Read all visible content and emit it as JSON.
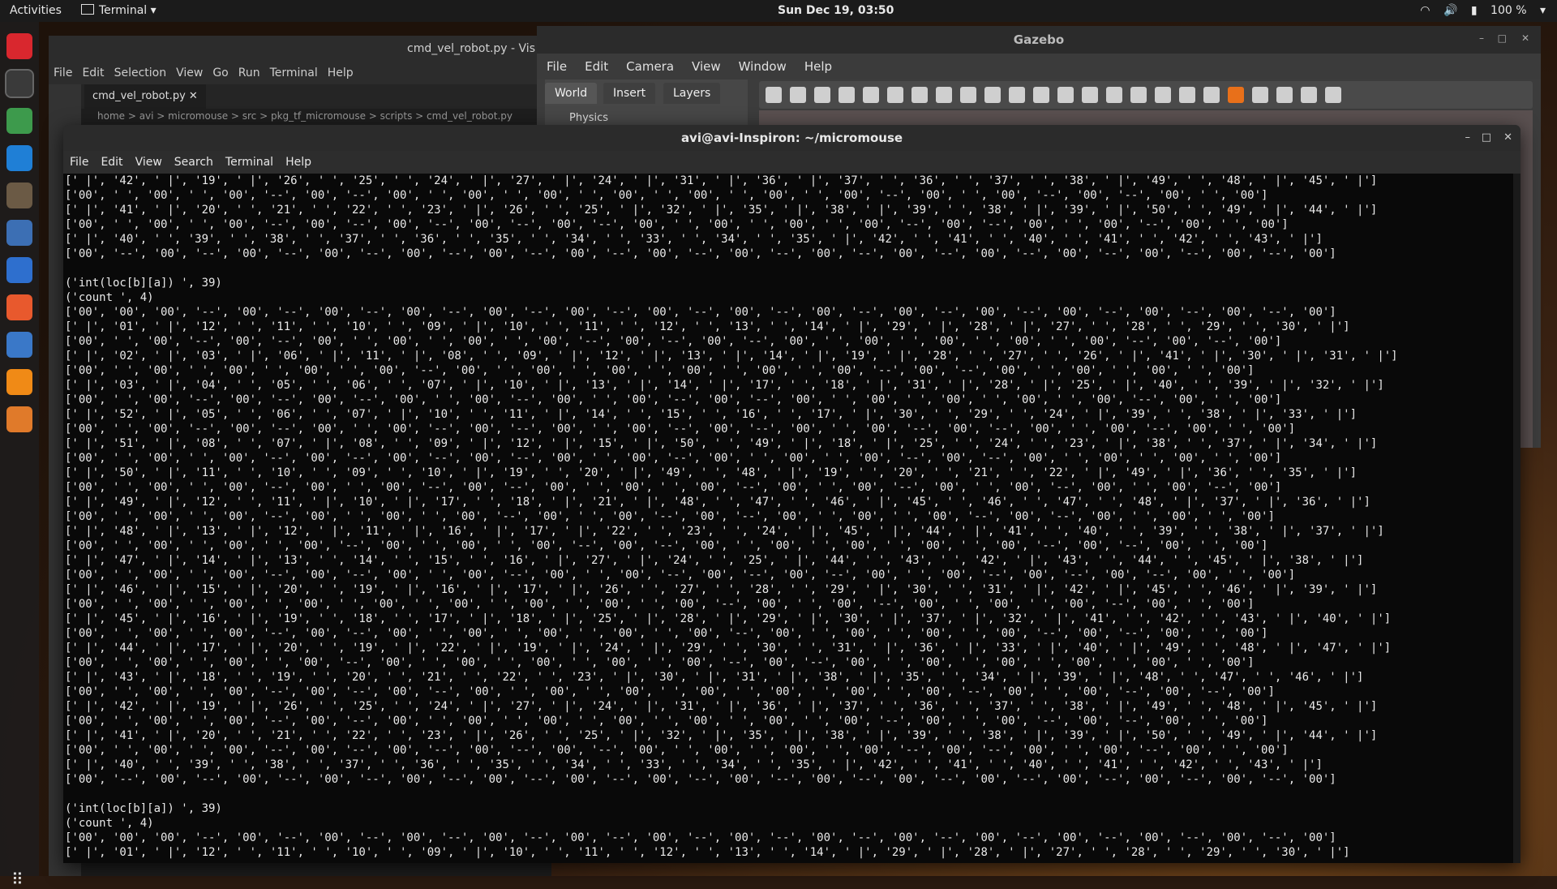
{
  "topbar": {
    "activities": "Activities",
    "app": "Terminal",
    "clock": "Sun Dec 19, 03:50",
    "battery": "100 %"
  },
  "dock": {
    "icons": [
      "opera-icon",
      "terminal-icon",
      "chrome-icon",
      "vscode-icon",
      "files-icon",
      "system-monitor-icon",
      "writer-icon",
      "software-icon",
      "help-icon",
      "vlc-icon",
      "layers-icon"
    ],
    "colors": [
      "#d9272e",
      "#3a3a3a",
      "#3d9a4c",
      "#1f7fd6",
      "#6b5a45",
      "#3c6fb4",
      "#2e6fce",
      "#e8592d",
      "#3a78c8",
      "#f08a16",
      "#e07a2a"
    ]
  },
  "vscode": {
    "title": "cmd_vel_robot.py - Vis",
    "menu": [
      "File",
      "Edit",
      "Selection",
      "View",
      "Go",
      "Run",
      "Terminal",
      "Help"
    ],
    "tab": "cmd_vel_robot.py",
    "breadcrumb": "home > avi > micromouse > src > pkg_tf_micromouse > scripts > cmd_vel_robot.py"
  },
  "gazebo": {
    "title": "Gazebo",
    "menu": [
      "File",
      "Edit",
      "Camera",
      "View",
      "Window",
      "Help"
    ],
    "tabs": [
      "World",
      "Insert",
      "Layers"
    ],
    "physics": "Physics"
  },
  "terminal": {
    "title": "avi@avi-Inspiron: ~/micromouse",
    "menu": [
      "File",
      "Edit",
      "View",
      "Search",
      "Terminal",
      "Help"
    ],
    "lines": [
      "[' |', '42', ' |', '19', ' |', '26', ' ', '25', ' ', '24', ' |', '27', ' |', '24', ' |', '31', ' |', '36', ' |', '37', ' ', '36', ' ', '37', ' ', '38', ' |', '49', ' ', '48', ' |', '45', ' |']",
      "['00', ' ', '00', ' ', '00', '--', '00', '--', '00', ' ', '00', ' ', '00', ' ', '00', ' ', '00', ' ', '00', ' ', '00', '--', '00', ' ', '00', '--', '00', '--', '00', ' ', '00']",
      "[' |', '41', ' |', '20', ' ', '21', ' ', '22', ' ', '23', ' |', '26', ' ', '25', ' |', '32', ' |', '35', ' |', '38', ' |', '39', ' ', '38', ' |', '39', ' |', '50', ' ', '49', ' |', '44', ' |']",
      "['00', ' ', '00', ' ', '00', '--', '00', '--', '00', '--', '00', '--', '00', '--', '00', ' ', '00', ' ', '00', ' ', '00', '--', '00', '--', '00', ' ', '00', '--', '00', ' ', '00']",
      "[' |', '40', ' ', '39', ' ', '38', ' ', '37', ' ', '36', ' ', '35', ' ', '34', ' ', '33', ' ', '34', ' ', '35', ' |', '42', ' ', '41', ' ', '40', ' ', '41', ' ', '42', ' ', '43', ' |']",
      "['00', '--', '00', '--', '00', '--', '00', '--', '00', '--', '00', '--', '00', '--', '00', '--', '00', '--', '00', '--', '00', '--', '00', '--', '00', '--', '00', '--', '00', '--', '00']",
      "",
      "('int(loc[b][a]) ', 39)",
      "('count ', 4)",
      "['00', '00', '00', '--', '00', '--', '00', '--', '00', '--', '00', '--', '00', '--', '00', '--', '00', '--', '00', '--', '00', '--', '00', '--', '00', '--', '00', '--', '00', '--', '00']",
      "[' |', '01', ' |', '12', ' ', '11', ' ', '10', ' ', '09', ' |', '10', ' ', '11', ' ', '12', ' ', '13', ' ', '14', ' |', '29', ' |', '28', ' |', '27', ' ', '28', ' ', '29', ' ', '30', ' |']",
      "['00', ' ', '00', '--', '00', '--', '00', ' ', '00', ' ', '00', ' ', '00', '--', '00', '--', '00', '--', '00', ' ', '00', ' ', '00', ' ', '00', ' ', '00', '--', '00', '--', '00']",
      "[' |', '02', ' |', '03', ' |', '06', ' |', '11', ' |', '08', ' ', '09', ' |', '12', ' |', '13', ' |', '14', ' |', '19', ' |', '28', ' ', '27', ' ', '26', ' |', '41', ' |', '30', ' |', '31', ' |']",
      "['00', ' ', '00', ' ', '00', ' ', '00', ' ', '00', '--', '00', ' ', '00', ' ', '00', ' ', '00', ' ', '00', ' ', '00', '--', '00', '--', '00', ' ', '00', ' ', '00', ' ', '00']",
      "[' |', '03', ' |', '04', ' ', '05', ' ', '06', ' ', '07', ' |', '10', ' |', '13', ' |', '14', ' |', '17', ' ', '18', ' |', '31', ' |', '28', ' |', '25', ' |', '40', ' ', '39', ' |', '32', ' |']",
      "['00', ' ', '00', '--', '00', '--', '00', '--', '00', ' ', '00', '--', '00', ' ', '00', '--', '00', '--', '00', ' ', '00', ' ', '00', ' ', '00', ' ', '00', '--', '00', ' ', '00']",
      "[' |', '52', ' |', '05', ' ', '06', ' ', '07', ' |', '10', ' ', '11', ' |', '14', ' ', '15', ' ', '16', ' ', '17', ' |', '30', ' ', '29', ' ', '24', ' |', '39', ' ', '38', ' |', '33', ' |']",
      "['00', ' ', '00', '--', '00', '--', '00', ' ', '00', '--', '00', '--', '00', ' ', '00', '--', '00', '--', '00', ' ', '00', '--', '00', '--', '00', ' ', '00', '--', '00', ' ', '00']",
      "[' |', '51', ' |', '08', ' ', '07', ' |', '08', ' ', '09', ' |', '12', ' |', '15', ' |', '50', ' ', '49', ' |', '18', ' |', '25', ' ', '24', ' ', '23', ' |', '38', ' ', '37', ' |', '34', ' |']",
      "['00', ' ', '00', ' ', '00', '--', '00', '--', '00', '--', '00', '--', '00', ' ', '00', '--', '00', ' ', '00', ' ', '00', '--', '00', '--', '00', ' ', '00', ' ', '00', ' ', '00']",
      "[' |', '50', ' |', '11', ' ', '10', ' ', '09', ' ', '10', ' |', '19', ' ', '20', ' |', '49', ' ', '48', ' |', '19', ' ', '20', ' ', '21', ' ', '22', ' |', '49', ' |', '36', ' ', '35', ' |']",
      "['00', ' ', '00', ' ', '00', '--', '00', ' ', '00', '--', '00', '--', '00', ' ', '00', ' ', '00', '--', '00', ' ', '00', '--', '00', ' ', '00', '--', '00', ' ', '00', '--', '00']",
      "[' |', '49', ' |', '12', ' ', '11', ' |', '10', ' |', '17', ' ', '18', ' |', '21', ' |', '48', ' ', '47', ' ', '46', ' |', '45', ' ', '46', ' ', '47', ' ', '48', ' |', '37', ' |', '36', ' |']",
      "['00', ' ', '00', ' ', '00', '--', '00', ' ', '00', ' ', '00', '--', '00', ' ', '00', '--', '00', '--', '00', ' ', '00', ' ', '00', '--', '00', '--', '00', ' ', '00', ' ', '00']",
      "[' |', '48', ' |', '13', ' |', '12', ' |', '11', ' |', '16', ' |', '17', ' |', '22', ' ', '23', ' ', '24', ' |', '45', ' |', '44', ' |', '41', ' ', '40', ' ', '39', ' ', '38', ' |', '37', ' |']",
      "['00', ' ', '00', ' ', '00', ' ', '00', '--', '00', ' ', '00', ' ', '00', '--', '00', '--', '00', ' ', '00', ' ', '00', ' ', '00', ' ', '00', '--', '00', '--', '00', ' ', '00']",
      "[' |', '47', ' |', '14', ' |', '13', ' ', '14', ' ', '15', ' ', '16', ' |', '27', ' |', '24', ' ', '25', ' |', '44', ' ', '43', ' ', '42', ' |', '43', ' ', '44', ' ', '45', ' |', '38', ' |']",
      "['00', ' ', '00', ' ', '00', '--', '00', '--', '00', ' ', '00', '--', '00', ' ', '00', '--', '00', '--', '00', '--', '00', ' ', '00', '--', '00', '--', '00', '--', '00', ' ', '00']",
      "[' |', '46', ' |', '15', ' |', '20', ' ', '19', ' |', '16', ' |', '17', ' |', '26', ' ', '27', ' ', '28', ' ', '29', ' |', '30', ' ', '31', ' |', '42', ' |', '45', ' ', '46', ' |', '39', ' |']",
      "['00', ' ', '00', ' ', '00', ' ', '00', ' ', '00', ' ', '00', ' ', '00', ' ', '00', ' ', '00', '--', '00', ' ', '00', '--', '00', ' ', '00', ' ', '00', '--', '00', ' ', '00']",
      "[' |', '45', ' |', '16', ' |', '19', ' ', '18', ' ', '17', ' |', '18', ' |', '25', ' |', '28', ' |', '29', ' |', '30', ' |', '37', ' |', '32', ' |', '41', ' ', '42', ' ', '43', ' |', '40', ' |']",
      "['00', ' ', '00', ' ', '00', '--', '00', '--', '00', ' ', '00', ' ', '00', ' ', '00', ' ', '00', '--', '00', ' ', '00', ' ', '00', ' ', '00', '--', '00', '--', '00', ' ', '00']",
      "[' |', '44', ' |', '17', ' |', '20', ' ', '19', ' |', '22', ' |', '19', ' |', '24', ' |', '29', ' ', '30', ' ', '31', ' |', '36', ' |', '33', ' |', '40', ' |', '49', ' ', '48', ' |', '47', ' |']",
      "['00', ' ', '00', ' ', '00', ' ', '00', '--', '00', ' ', '00', ' ', '00', ' ', '00', ' ', '00', '--', '00', '--', '00', ' ', '00', ' ', '00', ' ', '00', ' ', '00', ' ', '00']",
      "[' |', '43', ' |', '18', ' ', '19', ' ', '20', ' ', '21', ' ', '22', ' ', '23', ' |', '30', ' |', '31', ' |', '38', ' |', '35', ' ', '34', ' |', '39', ' |', '48', ' ', '47', ' ', '46', ' |']",
      "['00', ' ', '00', ' ', '00', '--', '00', '--', '00', '--', '00', ' ', '00', ' ', '00', ' ', '00', ' ', '00', ' ', '00', ' ', '00', '--', '00', ' ', '00', '--', '00', '--', '00']",
      "[' |', '42', ' |', '19', ' |', '26', ' ', '25', ' ', '24', ' |', '27', ' |', '24', ' |', '31', ' |', '36', ' |', '37', ' ', '36', ' ', '37', ' ', '38', ' |', '49', ' ', '48', ' |', '45', ' |']",
      "['00', ' ', '00', ' ', '00', '--', '00', '--', '00', ' ', '00', ' ', '00', ' ', '00', ' ', '00', ' ', '00', ' ', '00', '--', '00', ' ', '00', '--', '00', '--', '00', ' ', '00']",
      "[' |', '41', ' |', '20', ' ', '21', ' ', '22', ' ', '23', ' |', '26', ' ', '25', ' |', '32', ' |', '35', ' |', '38', ' |', '39', ' ', '38', ' |', '39', ' |', '50', ' ', '49', ' |', '44', ' |']",
      "['00', ' ', '00', ' ', '00', '--', '00', '--', '00', '--', '00', '--', '00', '--', '00', ' ', '00', ' ', '00', ' ', '00', '--', '00', '--', '00', ' ', '00', '--', '00', ' ', '00']",
      "[' |', '40', ' ', '39', ' ', '38', ' ', '37', ' ', '36', ' ', '35', ' ', '34', ' ', '33', ' ', '34', ' ', '35', ' |', '42', ' ', '41', ' ', '40', ' ', '41', ' ', '42', ' ', '43', ' |']",
      "['00', '--', '00', '--', '00', '--', '00', '--', '00', '--', '00', '--', '00', '--', '00', '--', '00', '--', '00', '--', '00', '--', '00', '--', '00', '--', '00', '--', '00', '--', '00']",
      "",
      "('int(loc[b][a]) ', 39)",
      "('count ', 4)",
      "['00', '00', '00', '--', '00', '--', '00', '--', '00', '--', '00', '--', '00', '--', '00', '--', '00', '--', '00', '--', '00', '--', '00', '--', '00', '--', '00', '--', '00', '--', '00']",
      "[' |', '01', ' |', '12', ' ', '11', ' ', '10', ' ', '09', ' |', '10', ' ', '11', ' ', '12', ' ', '13', ' ', '14', ' |', '29', ' |', '28', ' |', '27', ' ', '28', ' ', '29', ' ', '30', ' |']"
    ]
  }
}
